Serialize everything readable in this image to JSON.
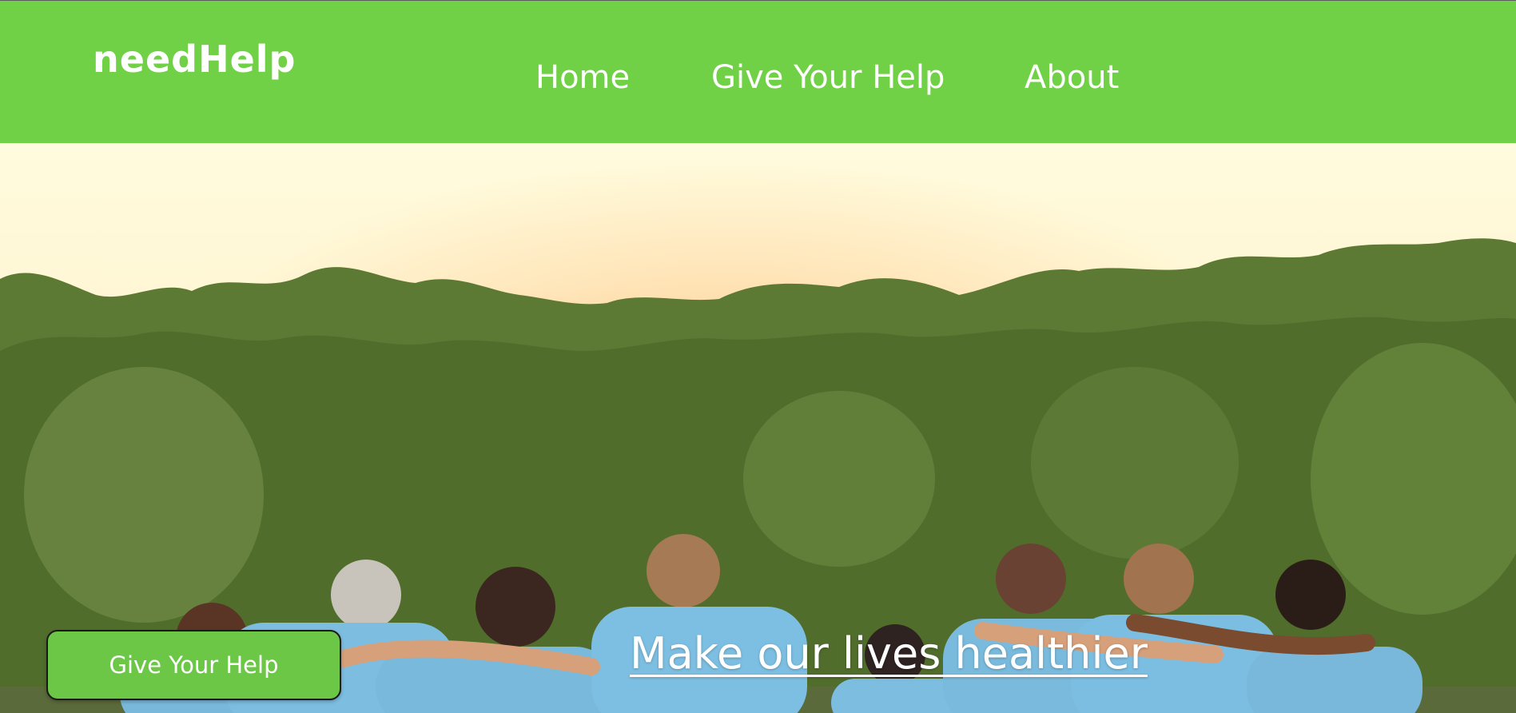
{
  "header": {
    "brand": "needHelp",
    "nav": [
      {
        "label": "Home"
      },
      {
        "label": "Give Your Help"
      },
      {
        "label": "About"
      }
    ]
  },
  "hero": {
    "button_label": "Give Your Help",
    "headline": "Make our lives healthier",
    "image_description_icon": "volunteers-photo"
  },
  "colors": {
    "nav_background": "#70d046",
    "button_background": "#6bc745",
    "text": "#ffffff"
  }
}
